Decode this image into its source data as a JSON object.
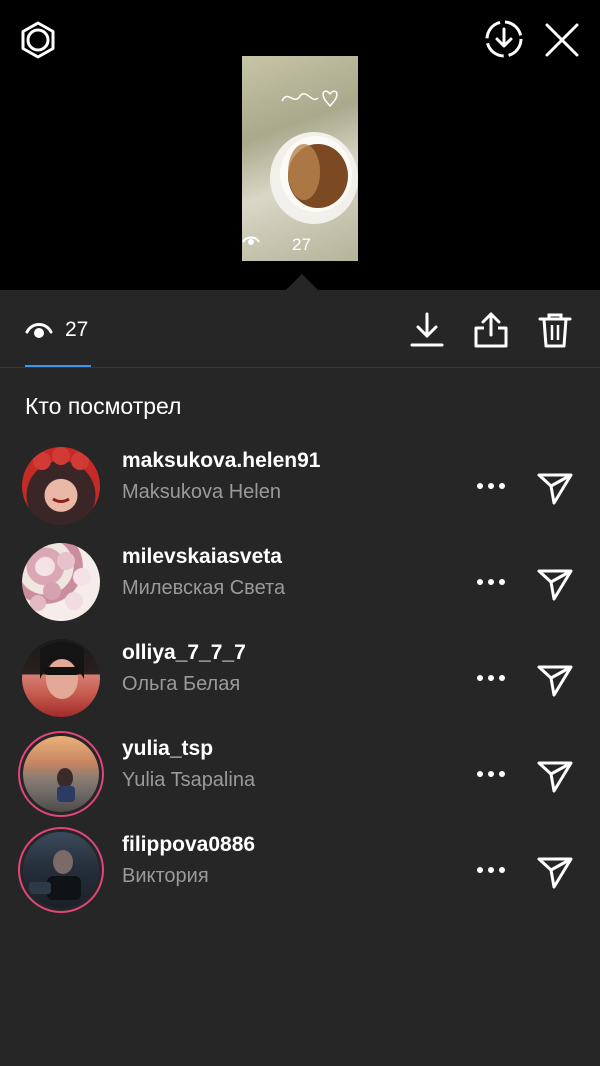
{
  "header": {
    "story_views": "27"
  },
  "tabs": {
    "views_count": "27"
  },
  "section": {
    "title": "Кто посмотрел"
  },
  "viewers": [
    {
      "username": "maksukova.helen91",
      "name": "Maksukova Helen"
    },
    {
      "username": "milevskaiasveta",
      "name": "Милевская Света"
    },
    {
      "username": "olliya_7_7_7",
      "name": "Ольга Белая"
    },
    {
      "username": "yulia_tsp",
      "name": "Yulia Tsapalina"
    },
    {
      "username": "filippova0886",
      "name": "Виктория"
    }
  ],
  "colors": {
    "accent": "#3897f0",
    "story_ring": "#e0457b"
  },
  "icons": [
    "settings-icon",
    "save-circle-icon",
    "close-icon",
    "eye-icon",
    "download-icon",
    "share-icon",
    "trash-icon",
    "more-icon",
    "send-icon"
  ]
}
